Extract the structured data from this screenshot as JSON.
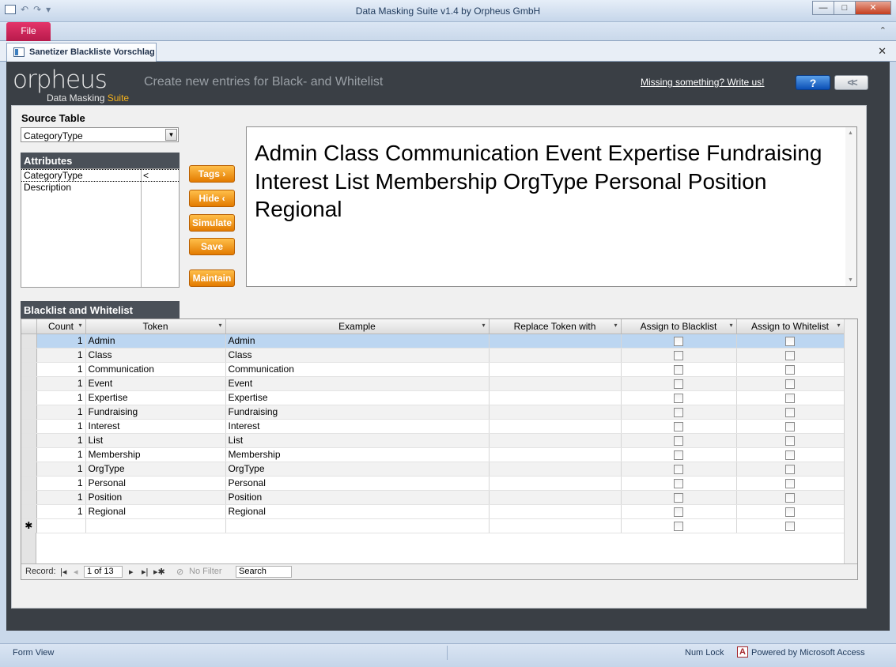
{
  "window": {
    "title": "Data Masking Suite v1.4 by Orpheus GmbH",
    "buttons": {
      "minimize": "—",
      "maximize": "□",
      "close": "✕"
    }
  },
  "qat": {
    "undo": "↶",
    "redo": "↷"
  },
  "ribbon": {
    "file_label": "File",
    "collapse": "⌃"
  },
  "tab": {
    "label": "Sanetizer Blackliste Vorschlag",
    "close": "✕"
  },
  "header": {
    "logo_text": "orpheus",
    "logo_sub_prefix": "Data Masking",
    "logo_sub_suite": "Suite",
    "tagline": "Create new entries for Black- and Whitelist",
    "missing_link": "Missing something? Write us!",
    "help_label": "?",
    "back_label": "<<"
  },
  "source": {
    "label": "Source Table",
    "value": "CategoryType"
  },
  "attributes": {
    "label": "Attributes",
    "items": [
      {
        "name": "CategoryType",
        "marker": "<"
      },
      {
        "name": "Description",
        "marker": ""
      }
    ]
  },
  "buttons": {
    "tags": "Tags ›",
    "hide": "Hide ‹",
    "simulate": "Simulate",
    "save": "Save",
    "maintain": "Maintain"
  },
  "preview_text": "Admin Class Communication Event Expertise Fundraising Interest List Membership OrgType Personal Position Regional",
  "bw_section": {
    "label": "Blacklist and Whitelist",
    "columns": [
      "Count",
      "Token",
      "Example",
      "Replace Token with",
      "Assign to Blacklist",
      "Assign to Whitelist"
    ],
    "rows": [
      {
        "count": "1",
        "token": "Admin",
        "example": "Admin",
        "replace": ""
      },
      {
        "count": "1",
        "token": "Class",
        "example": "Class",
        "replace": ""
      },
      {
        "count": "1",
        "token": "Communication",
        "example": "Communication",
        "replace": ""
      },
      {
        "count": "1",
        "token": "Event",
        "example": "Event",
        "replace": ""
      },
      {
        "count": "1",
        "token": "Expertise",
        "example": "Expertise",
        "replace": ""
      },
      {
        "count": "1",
        "token": "Fundraising",
        "example": "Fundraising",
        "replace": ""
      },
      {
        "count": "1",
        "token": "Interest",
        "example": "Interest",
        "replace": ""
      },
      {
        "count": "1",
        "token": "List",
        "example": "List",
        "replace": ""
      },
      {
        "count": "1",
        "token": "Membership",
        "example": "Membership",
        "replace": ""
      },
      {
        "count": "1",
        "token": "OrgType",
        "example": "OrgType",
        "replace": ""
      },
      {
        "count": "1",
        "token": "Personal",
        "example": "Personal",
        "replace": ""
      },
      {
        "count": "1",
        "token": "Position",
        "example": "Position",
        "replace": ""
      },
      {
        "count": "1",
        "token": "Regional",
        "example": "Regional",
        "replace": ""
      }
    ],
    "new_row_marker": "✱"
  },
  "navigator": {
    "record_label": "Record:",
    "record_value": "1 of 13",
    "first": "|◂",
    "prev": "◂",
    "next": "▸",
    "last": "▸|",
    "new": "▸✱",
    "no_filter": "No Filter",
    "search_placeholder": "Search"
  },
  "status": {
    "view": "Form View",
    "numlock": "Num Lock",
    "access_icon_letter": "A",
    "powered": "Powered by Microsoft Access"
  }
}
